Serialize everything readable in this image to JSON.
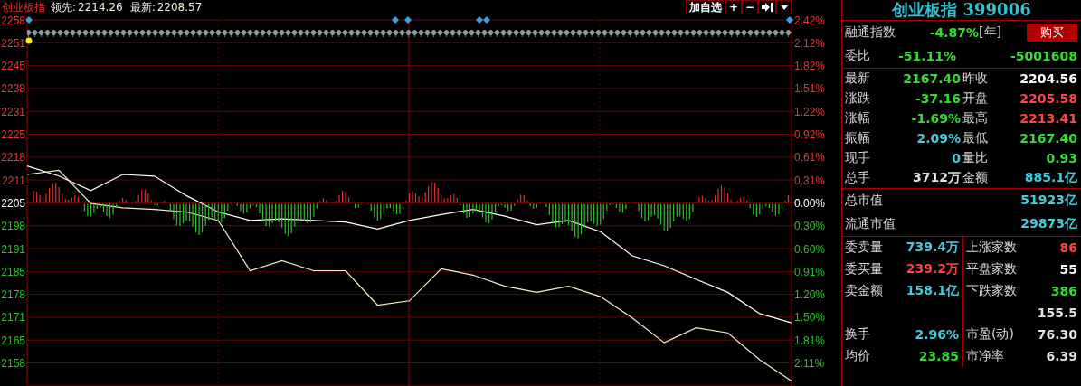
{
  "header": {
    "title": "创业板指",
    "leading_label": "领先:",
    "leading_value": "2214.26",
    "latest_label": "最新:",
    "latest_value": "2208.57",
    "buttons": [
      {
        "kind": "text",
        "label": "加自选"
      },
      {
        "kind": "text",
        "label": "+"
      },
      {
        "kind": "text",
        "label": "−"
      },
      {
        "kind": "jump"
      },
      {
        "kind": "dropdown"
      }
    ]
  },
  "chart": {
    "percent_ticks": [
      {
        "label": "2.42%",
        "color": "#e03838"
      },
      {
        "label": "2.12%",
        "color": "#e03838"
      },
      {
        "label": "1.82%",
        "color": "#e03838"
      },
      {
        "label": "1.51%",
        "color": "#e03838"
      },
      {
        "label": "1.22%",
        "color": "#e03838"
      },
      {
        "label": "0.92%",
        "color": "#e03838"
      },
      {
        "label": "0.61%",
        "color": "#e03838"
      },
      {
        "label": "0.31%",
        "color": "#e03838"
      },
      {
        "label": "0.00%",
        "color": "#ffffff"
      },
      {
        "label": "0.30%",
        "color": "#30c030"
      },
      {
        "label": "0.60%",
        "color": "#30c030"
      },
      {
        "label": "0.91%",
        "color": "#30c030"
      },
      {
        "label": "1.20%",
        "color": "#30c030"
      },
      {
        "label": "1.50%",
        "color": "#30c030"
      },
      {
        "label": "1.81%",
        "color": "#30c030"
      },
      {
        "label": "2.11%",
        "color": "#30c030"
      }
    ],
    "chart_data": {
      "type": "line",
      "grid": true,
      "ylim": [
        2151,
        2258
      ],
      "yticks": [
        2258,
        2251,
        2245,
        2238,
        2231,
        2225,
        2218,
        2211,
        2205,
        2198,
        2191,
        2185,
        2178,
        2171,
        2165,
        2158
      ],
      "series": [
        {
          "color": "#ffffff",
          "values": [
            2215.3,
            2212.2,
            2208.2,
            2212.7,
            2212.2,
            2206.9,
            2202.2,
            2199.6,
            2200.1,
            2199.6,
            2199.1,
            2197.0,
            2199.6,
            2201.4,
            2203.0,
            2200.9,
            2198.3,
            2199.6,
            2196.2,
            2189.1,
            2186.5,
            2182.6,
            2178.6,
            2172.1,
            2169.5
          ]
        },
        {
          "color": "#f2f2c8",
          "values": [
            2212.7,
            2214.0,
            2204.8,
            2203.5,
            2203.0,
            2202.2,
            2199.6,
            2185.2,
            2187.8,
            2185.2,
            2185.2,
            2174.7,
            2176.0,
            2185.7,
            2183.9,
            2180.5,
            2178.6,
            2180.5,
            2177.3,
            2170.8,
            2164.2,
            2168.2,
            2166.9,
            2159.0,
            2152.5
          ]
        }
      ]
    }
  },
  "panel": {
    "title": "创业板指 399006",
    "index_row": {
      "label": "融通指数",
      "value": "-4.87%",
      "color": "#33dd33",
      "tag": "[年]",
      "button": "购买"
    },
    "ratio_row": {
      "label": "委比",
      "cells": [
        {
          "value": "-51.11%",
          "color": "#33dd33"
        },
        {
          "value": "-5001608",
          "color": "#33dd33"
        }
      ]
    },
    "quotes": [
      {
        "left": {
          "label": "最新",
          "value": "2167.40",
          "color": "#33dd33"
        },
        "right": {
          "label": "昨收",
          "value": "2204.56",
          "color": "#ffffff"
        }
      },
      {
        "left": {
          "label": "涨跌",
          "value": "-37.16",
          "color": "#33dd33"
        },
        "right": {
          "label": "开盘",
          "value": "2205.58",
          "color": "#ff4444"
        }
      },
      {
        "left": {
          "label": "涨幅",
          "value": "-1.69%",
          "color": "#33dd33"
        },
        "right": {
          "label": "最高",
          "value": "2213.41",
          "color": "#ff4444"
        }
      },
      {
        "left": {
          "label": "振幅",
          "value": "2.09%",
          "color": "#44ccdd"
        },
        "right": {
          "label": "最低",
          "value": "2167.40",
          "color": "#33dd33"
        }
      },
      {
        "left": {
          "label": "现手",
          "value": "0",
          "color": "#44ccdd"
        },
        "right": {
          "label": "量比",
          "value": "0.93",
          "color": "#33dd33"
        }
      },
      {
        "left": {
          "label": "总手",
          "value": "3712万",
          "color": "#e0e0e0"
        },
        "right": {
          "label": "金额",
          "value": "885.1亿",
          "color": "#44ccdd"
        }
      }
    ],
    "market_values": [
      {
        "label": "总市值",
        "value": "51923亿",
        "color": "#44ccdd"
      },
      {
        "label": "流通市值",
        "value": "29873亿",
        "color": "#44ccdd"
      }
    ],
    "stats": [
      {
        "left": {
          "label": "委卖量",
          "value": "739.4万",
          "color": "#44ccdd"
        },
        "right": {
          "label": "上涨家数",
          "value": "86",
          "color": "#ff4444"
        }
      },
      {
        "left": {
          "label": "委买量",
          "value": "239.2万",
          "color": "#ff4444"
        },
        "right": {
          "label": "平盘家数",
          "value": "55",
          "color": "#ffffff"
        }
      },
      {
        "left": {
          "label": "卖金额",
          "value": "158.1亿",
          "color": "#44ccdd"
        },
        "right": {
          "label": "下跌家数",
          "value": "386",
          "color": "#33dd33"
        }
      },
      {
        "right": {
          "value": "155.5",
          "color": "#e0e0e0"
        }
      },
      {
        "left": {
          "label": "换手",
          "value": "2.96%",
          "color": "#44ccdd"
        },
        "right": {
          "label": "市盈(动)",
          "value": "76.30",
          "color": "#e0e0e0"
        }
      },
      {
        "left": {
          "label": "均价",
          "value": "23.85",
          "color": "#33dd33"
        },
        "right": {
          "label": "市净率",
          "value": "6.39",
          "color": "#e0e0e0"
        }
      }
    ]
  }
}
